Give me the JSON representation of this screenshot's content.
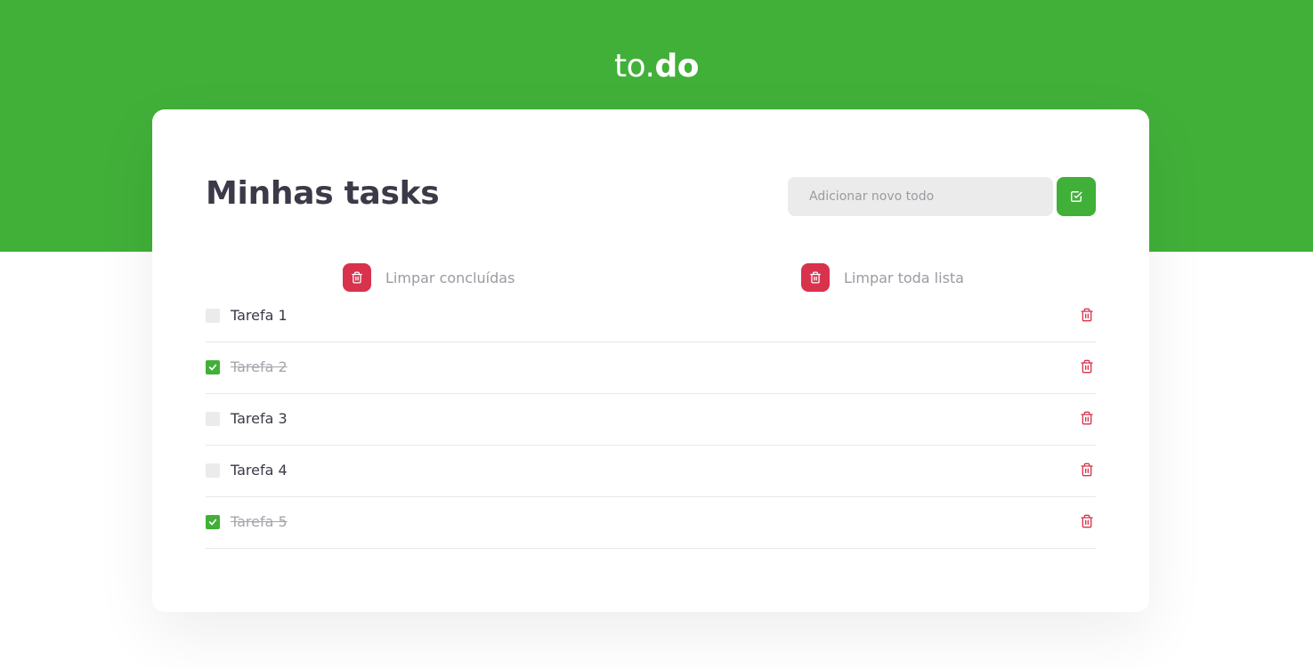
{
  "header": {
    "logo_light": "to.",
    "logo_bold": "do"
  },
  "main": {
    "title": "Minhas tasks",
    "new_todo_placeholder": "Adicionar novo todo",
    "add_button_icon": "check-square-icon",
    "clear_completed_label": "Limpar concluídas",
    "clear_all_label": "Limpar toda lista"
  },
  "tasks": [
    {
      "title": "Tarefa 1",
      "done": false
    },
    {
      "title": "Tarefa 2",
      "done": true
    },
    {
      "title": "Tarefa 3",
      "done": false
    },
    {
      "title": "Tarefa 4",
      "done": false
    },
    {
      "title": "Tarefa 5",
      "done": true
    }
  ],
  "colors": {
    "brand_green": "#41b039",
    "danger_red": "#d8324c",
    "text_dark": "#3a3a48",
    "text_muted": "#9a9aa2"
  }
}
